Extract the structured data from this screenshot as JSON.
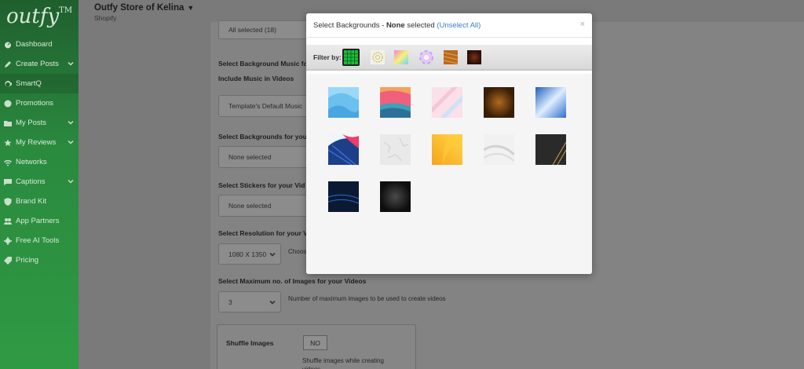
{
  "sidebar": {
    "logo": "outfy",
    "logo_tm": "TM",
    "items": [
      {
        "label": "Dashboard",
        "icon": "dashboard-icon",
        "chevron": false
      },
      {
        "label": "Create Posts",
        "icon": "pencil-icon",
        "chevron": true
      },
      {
        "label": "SmartQ",
        "icon": "sync-icon",
        "chevron": false,
        "active": true
      },
      {
        "label": "Promotions",
        "icon": "dollar-icon",
        "chevron": false
      },
      {
        "label": "My Posts",
        "icon": "folder-icon",
        "chevron": true
      },
      {
        "label": "My Reviews",
        "icon": "star-icon",
        "chevron": true
      },
      {
        "label": "Networks",
        "icon": "wifi-icon",
        "chevron": false
      },
      {
        "label": "Captions",
        "icon": "chat-icon",
        "chevron": true
      },
      {
        "label": "Brand Kit",
        "icon": "shield-icon",
        "chevron": false
      },
      {
        "label": "App Partners",
        "icon": "users-icon",
        "chevron": false
      },
      {
        "label": "Free AI Tools",
        "icon": "gear-icon",
        "chevron": false
      },
      {
        "label": "Pricing",
        "icon": "tag-icon",
        "chevron": false
      }
    ]
  },
  "header": {
    "store_name": "Outfy Store of Kelina",
    "store_caret": "▼",
    "platform": "Shopify"
  },
  "form": {
    "all_selected": "All selected (18)",
    "bg_music_label": "Select Background Music fo",
    "include_music_label": "Include Music in Videos",
    "music_value": "Template's Default Music",
    "backgrounds_label": "Select Backgrounds for you",
    "backgrounds_value": "None selected",
    "stickers_label": "Select Stickers for your Vid",
    "stickers_value": "None selected",
    "resolution_label": "Select Resolution for your V",
    "resolution_value": "1080 X 1350",
    "resolution_hint": "Choos",
    "max_images_label": "Select Maximum no. of Images for your Videos",
    "max_images_value": "3",
    "max_images_hint": "Number of maximum images to be used to create videos",
    "shuffle_label": "Shuffle Images",
    "shuffle_value": "NO",
    "shuffle_hint": "Shuffle images while creating",
    "shuffle_hint2": "videos"
  },
  "modal": {
    "title_prefix": "Select Backgrounds - ",
    "title_count": "None",
    "title_suffix": " selected ",
    "unselect_all": "(Unselect All)",
    "close": "×",
    "filter_label": "Filter by:",
    "filters": [
      {
        "icon": "grid-all-icon",
        "active": true
      },
      {
        "icon": "gear-pattern-icon",
        "active": false
      },
      {
        "icon": "gradient-icon",
        "active": false
      },
      {
        "icon": "color-wheel-icon",
        "active": false
      },
      {
        "icon": "wood-texture-icon",
        "active": false
      },
      {
        "icon": "dark-texture-icon",
        "active": false
      }
    ],
    "backgrounds": [
      {
        "name": "blue-shapes"
      },
      {
        "name": "pink-waves"
      },
      {
        "name": "pastel-stripes"
      },
      {
        "name": "brown-grunge"
      },
      {
        "name": "blue-light"
      },
      {
        "name": "blue-pink-palm"
      },
      {
        "name": "white-texture"
      },
      {
        "name": "orange-gradient"
      },
      {
        "name": "white-silk"
      },
      {
        "name": "black-gold-lines"
      },
      {
        "name": "dark-blue-lines"
      },
      {
        "name": "black-grunge"
      }
    ]
  }
}
